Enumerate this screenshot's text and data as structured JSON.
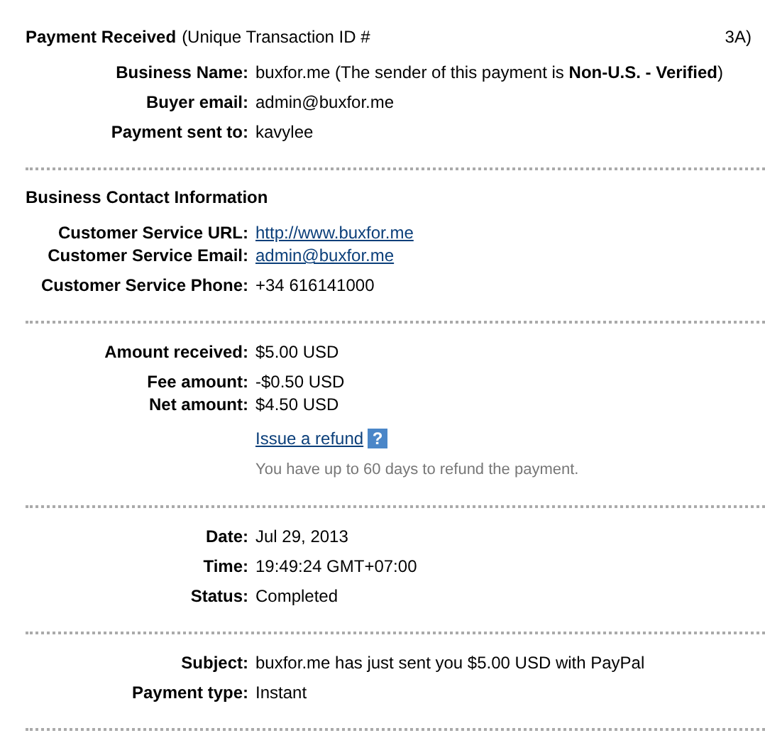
{
  "sections": [
    {
      "title": "Payment Received",
      "title_note": "(Unique Transaction ID #",
      "title_tail": "3A)",
      "groups": [
        [
          {
            "label": "Business Name:",
            "value": "buxfor.me (The sender of this payment is **Non-U.S. - Verified**)",
            "kind": "text"
          }
        ],
        [
          {
            "label": "Buyer email:",
            "value": "admin@buxfor.me",
            "kind": "text"
          }
        ],
        [
          {
            "label": "Payment sent to:",
            "value": "kavylee",
            "kind": "text"
          }
        ]
      ]
    },
    {
      "title": "Business Contact Information",
      "groups": [
        [
          {
            "label": "Customer Service URL:",
            "value": "http://www.buxfor.me",
            "kind": "link"
          },
          {
            "label": "Customer Service Email:",
            "value": "admin@buxfor.me",
            "kind": "link"
          }
        ],
        [
          {
            "label": "Customer Service Phone:",
            "value": "+34 616141000",
            "kind": "text"
          }
        ]
      ]
    },
    {
      "groups": [
        [
          {
            "label": "Amount received:",
            "value": "$5.00 USD",
            "kind": "text"
          }
        ],
        [
          {
            "label": "Fee amount:",
            "value": "-$0.50 USD",
            "kind": "text"
          },
          {
            "label": "Net amount:",
            "value": "$4.50 USD",
            "kind": "text"
          }
        ],
        [
          {
            "value": "Issue a refund",
            "kind": "refund",
            "help": "?",
            "note": "You have up to 60 days to refund the payment."
          }
        ]
      ]
    },
    {
      "groups": [
        [
          {
            "label": "Date:",
            "value": "Jul 29, 2013",
            "kind": "text"
          }
        ],
        [
          {
            "label": "Time:",
            "value": "19:49:24 GMT+07:00",
            "kind": "text"
          }
        ],
        [
          {
            "label": "Status:",
            "value": "Completed",
            "kind": "text"
          }
        ]
      ]
    },
    {
      "groups": [
        [
          {
            "label": "Subject:",
            "value": "buxfor.me has just sent you $5.00 USD with PayPal",
            "kind": "text"
          }
        ],
        [
          {
            "label": "Payment type:",
            "value": "Instant",
            "kind": "text"
          }
        ]
      ]
    }
  ]
}
